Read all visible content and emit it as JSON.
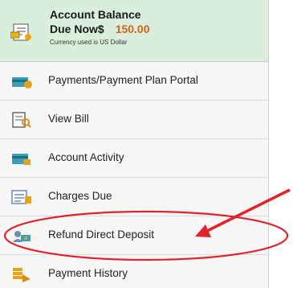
{
  "balance": {
    "title": "Account Balance",
    "due_label": "Due Now$",
    "amount": "150.00",
    "currency_note": "Currency used is US Dollar",
    "amount_color": "#d1641c",
    "icon": "bill-icon"
  },
  "menu": {
    "items": [
      {
        "label": "Payments/Payment Plan Portal",
        "icon": "payment-portal-icon"
      },
      {
        "label": "View Bill",
        "icon": "view-bill-icon"
      },
      {
        "label": "Account Activity",
        "icon": "account-activity-icon"
      },
      {
        "label": "Charges Due",
        "icon": "charges-due-icon"
      },
      {
        "label": "Refund Direct Deposit",
        "icon": "refund-deposit-icon"
      },
      {
        "label": "Payment History",
        "icon": "payment-history-icon"
      }
    ]
  },
  "annotation": {
    "color": "#e0242a",
    "highlighted_item": "Refund Direct Deposit"
  }
}
